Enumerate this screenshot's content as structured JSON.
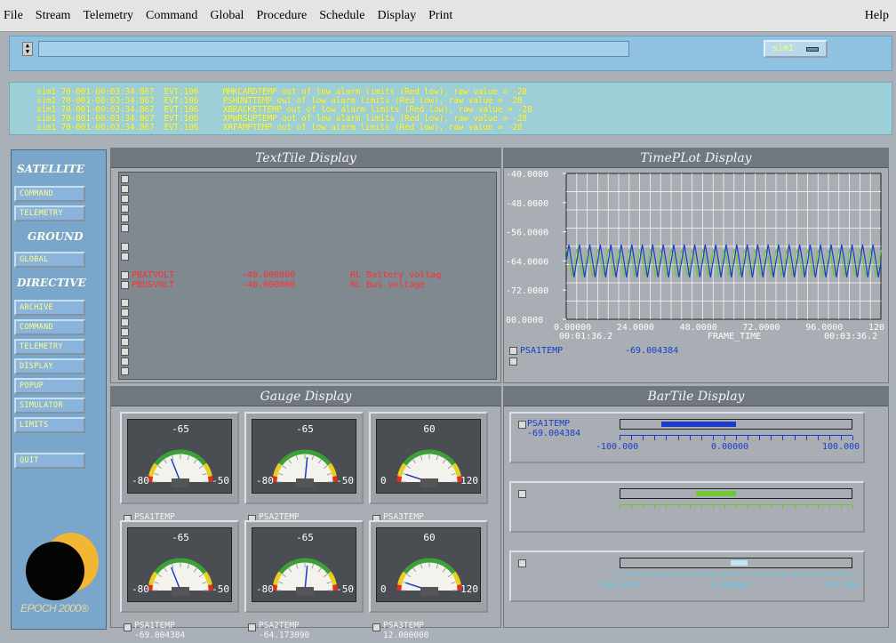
{
  "menu": {
    "items": [
      "File",
      "Stream",
      "Telemetry",
      "Command",
      "Global",
      "Procedure",
      "Schedule",
      "Display",
      "Print"
    ],
    "help": "Help"
  },
  "command_bar": {
    "input_value": "",
    "stream_select": "sim1"
  },
  "event_log": [
    "sim1 70-001-00:03:34.867  EVT:106     MHKCARDTEMP out of low alarm limits (Red low), raw value = -28",
    "sim1 70-001-00:03:34.867  EVT:106     PSHUNTTEMP out of low alarm limits (Red low), raw value = -28",
    "sim1 70-001-00:03:34.867  EVT:106     XBRACKETTEMP out of low alarm limits (Red low), raw value = -28",
    "sim1 70-001-00:03:34.867  EVT:106     XPWRSUPTEMP out of low alarm limits (Red low), raw value = -28",
    "sim1 70-001-00:03:34.867  EVT:106     XRFAMPTEMP out of low alarm limits (Red low), raw value = -28"
  ],
  "nav": {
    "satellite": "SATELLITE",
    "satellite_buttons": [
      "COMMAND",
      "TELEMETRY"
    ],
    "ground": "GROUND",
    "ground_buttons": [
      "GLOBAL"
    ],
    "directive": "DIRECTIVE",
    "directive_buttons": [
      "ARCHIVE",
      "COMMAND",
      "TELEMETRY",
      "DISPLAY",
      "POPUP",
      "SIMULATOR",
      "LIMITS"
    ],
    "quit": "QUIT",
    "brand": "EPOCH 2000®"
  },
  "panels": {
    "text_tile": "TextTile Display",
    "time_plot": "TimePLot Display",
    "gauge": "Gauge Display",
    "bar_tile": "BarTile Display"
  },
  "text_tile_rows": [
    {
      "name": "",
      "value": "",
      "status": "",
      "color": "green"
    },
    {
      "name": "",
      "value": "",
      "status": "",
      "color": "green"
    },
    {
      "name": "",
      "value": "",
      "status": "",
      "color": "green"
    },
    {
      "name": "",
      "value": "",
      "status": "",
      "color": "green"
    },
    {
      "name": "",
      "value": "",
      "status": "",
      "color": "green"
    },
    {
      "name": "",
      "value": "",
      "status": "",
      "color": "green"
    },
    {
      "name": "",
      "value": "",
      "status": "",
      "color": "green"
    },
    {
      "name": "",
      "value": "",
      "status": "",
      "color": "green"
    },
    {
      "name": "PBATVOLT",
      "value": "-40.000000",
      "status": "RL Battery voltag",
      "color": "red"
    },
    {
      "name": "PBUSVOLT",
      "value": "-40.000000",
      "status": "RL Bus voltage",
      "color": "red"
    },
    {
      "name": "",
      "value": "",
      "status": "",
      "color": "green"
    },
    {
      "name": "",
      "value": "",
      "status": "",
      "color": "green"
    }
  ],
  "time_plot": {
    "y_ticks": [
      "-40.0000",
      "-48.0000",
      "-56.0000",
      "-64.0000",
      "-72.0000",
      "00.0000"
    ],
    "x_ticks": [
      "0.00000",
      "24.0000",
      "48.0000",
      "72.0000",
      "96.0000",
      "120.000"
    ],
    "x_start": "00:01:36.2",
    "x_label": "FRAME_TIME",
    "x_end": "00:03:36.2",
    "legend": [
      {
        "name": "PSA1TEMP",
        "value": "-69.004384",
        "color": "#1a3cc8"
      },
      {
        "name": "",
        "value": "",
        "color": "#6ec83a"
      }
    ]
  },
  "gauges": [
    {
      "min": "-80",
      "mid": "-65",
      "max": "-50",
      "name": "PSA1TEMP",
      "value": "-69.004384",
      "level": 0.38
    },
    {
      "min": "-80",
      "mid": "-65",
      "max": "-50",
      "name": "PSA2TEMP",
      "value": "-64.173090",
      "level": 0.53
    },
    {
      "min": "0",
      "mid": "60",
      "max": "120",
      "name": "PSA3TEMP",
      "value": "12.000000",
      "level": 0.1
    },
    {
      "min": "-80",
      "mid": "-65",
      "max": "-50",
      "name": "PSA1TEMP",
      "value": "-69.004384",
      "level": 0.38
    },
    {
      "min": "-80",
      "mid": "-65",
      "max": "-50",
      "name": "PSA2TEMP",
      "value": "-64.173090",
      "level": 0.53
    },
    {
      "min": "0",
      "mid": "60",
      "max": "120",
      "name": "PSA3TEMP",
      "value": "12.000000",
      "level": 0.1
    }
  ],
  "bars": [
    {
      "name": "PSA1TEMP",
      "value": "-69.004384",
      "min": "-100.000",
      "mid": "0.00000",
      "max": "100.000",
      "text_color": "#1a3cc8",
      "bar_color": "#1a3cc8",
      "lo": -65,
      "hi": 0
    },
    {
      "name": "",
      "value": "",
      "min": "",
      "mid": "",
      "max": "",
      "text_color": "#6ec83a",
      "bar_color": "#6ec83a",
      "lo": -35,
      "hi": 0
    },
    {
      "name": "",
      "value": "",
      "min": "-100.000",
      "mid": "0.00000",
      "max": "100.000",
      "text_color": "#6ec8e8",
      "bar_color": "#bfe6f4",
      "lo": -5,
      "hi": 10
    }
  ]
}
